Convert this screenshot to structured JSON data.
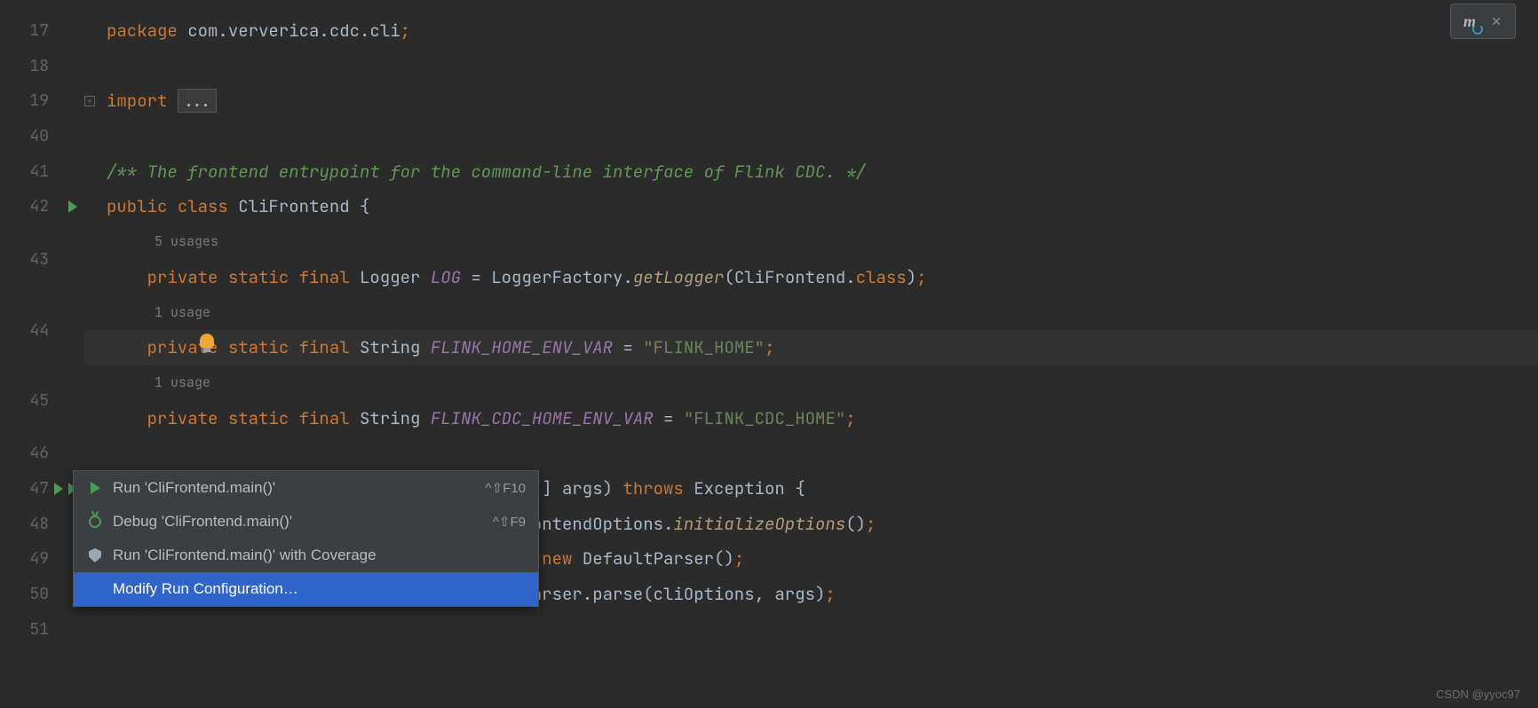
{
  "gutter": {
    "line_numbers": [
      "17",
      "18",
      "19",
      "40",
      "41",
      "42",
      "43",
      "44",
      "45",
      "46",
      "47",
      "48",
      "49",
      "50",
      "51"
    ]
  },
  "code": {
    "line17": {
      "kw_package": "package",
      "pkg": " com.ververica.cdc.cli",
      "semi": ";"
    },
    "line19": {
      "kw_import": "import ",
      "folded": "..."
    },
    "line41": {
      "comment": "/** The frontend entrypoint for the command-line interface of Flink CDC. */"
    },
    "line42": {
      "kw_public": "public ",
      "kw_class": "class ",
      "name": "CliFrontend ",
      "brace": "{"
    },
    "line42_usage": "5 usages",
    "line43": {
      "kw_private": "private ",
      "kw_static": "static ",
      "kw_final": "final ",
      "type": "Logger ",
      "field": "LOG",
      "eq": " = ",
      "factory": "LoggerFactory.",
      "method": "getLogger",
      "paren": "(",
      "arg": "CliFrontend.",
      "kw_class2": "class",
      "close": ")",
      "semi": ";"
    },
    "line43_usage": "1 usage",
    "line44": {
      "kw_private": "private ",
      "kw_static": "static ",
      "kw_final": "final ",
      "type": "String ",
      "field": "FLINK_HOME_ENV_VAR",
      "eq": " = ",
      "str": "\"FLINK_HOME\"",
      "semi": ";"
    },
    "line44_usage": "1 usage",
    "line45": {
      "kw_private": "private ",
      "kw_static": "static ",
      "kw_final": "final ",
      "type": "String ",
      "field": "FLINK_CDC_HOME_ENV_VAR",
      "eq": " = ",
      "str": "\"FLINK_CDC_HOME\"",
      "semi": ";"
    },
    "line47": {
      "text_a": "g[] args) ",
      "kw_throws": "throws ",
      "exc": "Exception ",
      "brace": "{"
    },
    "line48": {
      "text_a": "rontendOptions.",
      "method": "initializeOptions",
      "paren": "()",
      "semi": ";"
    },
    "line49": {
      "text_a": "= ",
      "kw_new": "new ",
      "ctor": "DefaultParser()",
      "semi": ";"
    },
    "line50": {
      "text_a": "parser.parse(cliOptions, args)",
      "semi": ";"
    }
  },
  "menu": {
    "items": [
      {
        "icon": "play",
        "label": "Run 'CliFrontend.main()'",
        "shortcut": "^⇧F10"
      },
      {
        "icon": "debug",
        "label": "Debug 'CliFrontend.main()'",
        "shortcut": "^⇧F9"
      },
      {
        "icon": "shield",
        "label": "Run 'CliFrontend.main()' with Coverage",
        "shortcut": ""
      },
      {
        "icon": "",
        "label": "Modify Run Configuration…",
        "shortcut": ""
      }
    ]
  },
  "toolbar": {
    "m_label": "m"
  },
  "watermark": "CSDN @yyoc97"
}
